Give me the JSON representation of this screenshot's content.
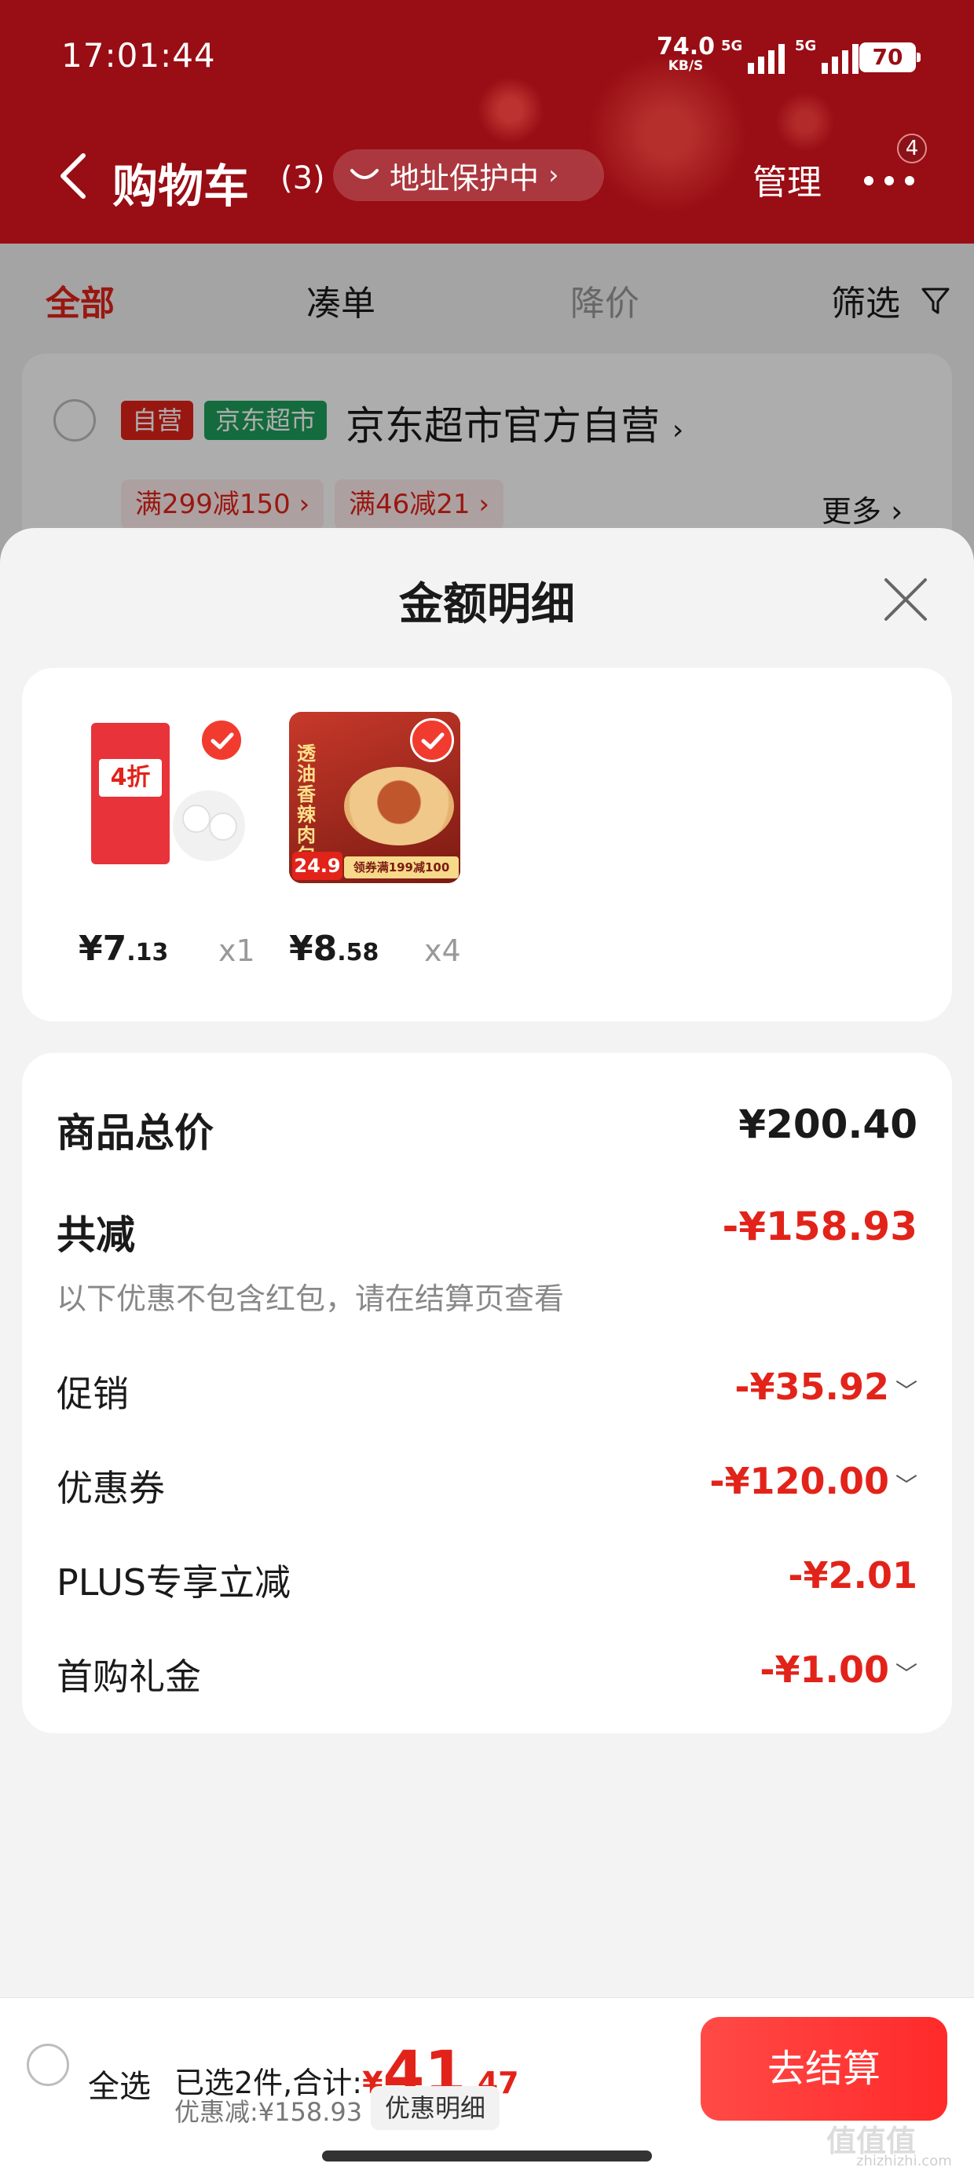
{
  "status_bar": {
    "time": "17:01:44",
    "net_speed": "74.0",
    "net_unit": "KB/S",
    "sim1": "5G",
    "sim2": "5G",
    "battery": "70"
  },
  "nav": {
    "title": "购物车",
    "count": "(3)",
    "address_protect": "地址保护中",
    "manage": "管理",
    "more_badge": "4"
  },
  "tabs": [
    {
      "label": "全部",
      "state": "active"
    },
    {
      "label": "凑单",
      "state": "normal"
    },
    {
      "label": "降价",
      "state": "disabled"
    },
    {
      "label": "筛选",
      "state": "normal"
    }
  ],
  "shop": {
    "tag_self": "自营",
    "tag_market": "京东超市",
    "name": "京东超市官方自营",
    "promos": [
      "满299减150",
      "满46减21"
    ],
    "more": "更多"
  },
  "sheet": {
    "title": "金额明细",
    "items": [
      {
        "price_main": "¥7",
        "price_dec": ".13",
        "qty": "x1",
        "thumb_text": "4折"
      },
      {
        "price_main": "¥8",
        "price_dec": ".58",
        "qty": "x4",
        "thumb_text": "透油香辣肉包",
        "thumb_price": "24.9",
        "thumb_coupon": "领券满199减100"
      }
    ],
    "total_label": "商品总价",
    "total_value": "¥200.40",
    "reduce_label": "共减",
    "reduce_value": "-¥158.93",
    "note": "以下优惠不包含红包，请在结算页查看",
    "lines": [
      {
        "label": "促销",
        "value": "-¥35.92",
        "expandable": true
      },
      {
        "label": "优惠券",
        "value": "-¥120.00",
        "expandable": true
      },
      {
        "label": "PLUS专享立减",
        "value": "-¥2.01",
        "expandable": false
      },
      {
        "label": "首购礼金",
        "value": "-¥1.00",
        "expandable": true
      }
    ]
  },
  "bottom": {
    "select_all": "全选",
    "selected_prefix": "已选2件,合计:",
    "total_yen": "¥",
    "total_int": "41",
    "total_dec": ".47",
    "discount": "优惠减:¥158.93",
    "detail_btn": "优惠明细",
    "checkout": "去结算"
  },
  "colors": {
    "header": "#990d14",
    "accent_red": "#e2231a",
    "checkout": "#ff3b36"
  },
  "watermark": "值值值",
  "watermark_sub": "zhizhizhi.com"
}
